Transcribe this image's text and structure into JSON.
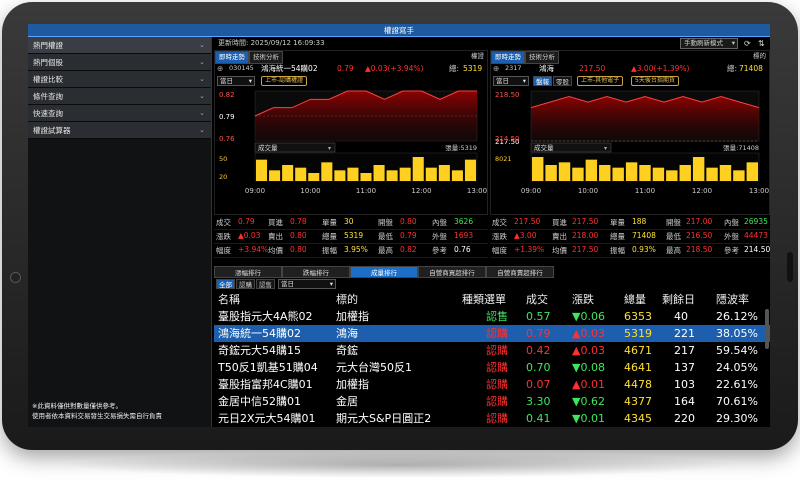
{
  "window": {
    "title": "權證寫手"
  },
  "sidebar": {
    "items": [
      {
        "label": "熱門權證"
      },
      {
        "label": "熱門個股"
      },
      {
        "label": "權證比較"
      },
      {
        "label": "條件查詢"
      },
      {
        "label": "快速查詢"
      },
      {
        "label": "權證試算器"
      }
    ],
    "disclaimer_1": "※此資料僅供對數量僅供參考。",
    "disclaimer_2": "使用者依本資料交易發生交易損失需自行負責"
  },
  "topbar": {
    "updated": "更新時間: 2025/09/12 16:09:33",
    "refresh_mode": "手動刷新模式"
  },
  "left_panel": {
    "tab_live": "即時走勢",
    "tab_tech": "技術分析",
    "tab_right": "權證",
    "code": "030145",
    "name": "鴻海統一54購02",
    "price": "0.79",
    "change": "▲0.03(+3.94%)",
    "vol_label": "總:",
    "volume": "5319",
    "period": "當日",
    "tag1": "上市-認購權證",
    "volume_dd": "成交量",
    "vol_readout": "張量:5319"
  },
  "right_panel": {
    "tab_live": "即時走勢",
    "tab_tech": "技術分析",
    "tab_right": "標的",
    "code": "2317",
    "name": "鴻海",
    "price": "217.50",
    "change": "▲3.00(+1.39%)",
    "vol_label": "總:",
    "volume": "71408",
    "period": "當日",
    "mini_tab1": "盤報",
    "mini_tab2": "零股",
    "tag1": "上市-其他電子",
    "tag2": "5天後台指期貨",
    "volume_dd": "成交量",
    "vol_readout": "張量:71408"
  },
  "chart_data": [
    {
      "type": "line",
      "title": "鴻海統一54購02",
      "x": [
        "09:00",
        "10:00",
        "11:00",
        "12:00",
        "13:00"
      ],
      "y_ticks": [
        "0.82",
        "0.79",
        "0.76",
        "50",
        "20"
      ],
      "ylim": [
        0.76,
        0.82
      ],
      "reference": 0.79,
      "series": [
        {
          "values": [
            0.79,
            0.8,
            0.8,
            0.81,
            0.81,
            0.82,
            0.82,
            0.81,
            0.82,
            0.82,
            0.81,
            0.82,
            0.82
          ]
        }
      ],
      "volume_bars": [
        8,
        4,
        6,
        5,
        3,
        7,
        4,
        5,
        3,
        6,
        4,
        5,
        9,
        5,
        6,
        4,
        8
      ]
    },
    {
      "type": "line",
      "title": "鴻海",
      "x": [
        "09:00",
        "10:00",
        "11:00",
        "12:00",
        "13:00"
      ],
      "y_ticks": [
        "218.50",
        "217.50",
        "214.50",
        "8021"
      ],
      "ylim": [
        214.5,
        219
      ],
      "reference": 214.5,
      "series": [
        {
          "values": [
            217.5,
            218.0,
            218.5,
            218.0,
            218.5,
            218.0,
            218.5,
            218.0,
            218.5,
            218.0,
            218.5,
            218.0,
            217.5
          ]
        }
      ],
      "volume_bars": [
        9,
        6,
        7,
        5,
        8,
        6,
        5,
        7,
        6,
        5,
        4,
        6,
        9,
        5,
        6,
        4,
        7
      ]
    }
  ],
  "left_grid": [
    [
      "成交",
      "0.79",
      "買進",
      "0.78",
      "單量",
      "30",
      "開盤",
      "0.80",
      "內盤",
      "3626"
    ],
    [
      "漲跌",
      "▲0.03",
      "賣出",
      "0.80",
      "總量",
      "5319",
      "最低",
      "0.79",
      "外盤",
      "1693"
    ],
    [
      "幅度",
      "+3.94%",
      "均價",
      "0.80",
      "振幅",
      "3.95%",
      "最高",
      "0.82",
      "參考",
      "0.76"
    ]
  ],
  "right_grid": [
    [
      "成交",
      "217.50",
      "買進",
      "217.50",
      "單量",
      "188",
      "開盤",
      "217.00",
      "內盤",
      "26935"
    ],
    [
      "漲跌",
      "▲3.00",
      "賣出",
      "218.00",
      "總量",
      "71408",
      "最低",
      "216.50",
      "外盤",
      "44473"
    ],
    [
      "幅度",
      "+1.39%",
      "均價",
      "217.50",
      "振幅",
      "0.93%",
      "最高",
      "218.50",
      "參考",
      "214.50"
    ]
  ],
  "category_tabs": [
    "漲幅排行",
    "跌幅排行",
    "成量排行",
    "自營商買超排行",
    "自營商賣超排行"
  ],
  "filters": {
    "all": "全部",
    "call": "認購",
    "put": "認售",
    "period": "當日"
  },
  "table": {
    "headers": [
      "名稱",
      "標的",
      "種類選單",
      "成交",
      "漲跌",
      "總量",
      "剩餘日",
      "隱波率"
    ],
    "rows": [
      [
        "臺股指元大4A熊02",
        "加權指",
        "認售",
        "0.57",
        "▼0.06",
        "6353",
        "40",
        "26.12%"
      ],
      [
        "鴻海統一54購02",
        "鴻海",
        "認購",
        "0.79",
        "▲0.03",
        "5319",
        "221",
        "38.05%"
      ],
      [
        "奇鋐元大54購15",
        "奇鋐",
        "認購",
        "0.42",
        "▲0.03",
        "4671",
        "217",
        "59.54%"
      ],
      [
        "T50反1凱基51購04",
        "元大台灣50反1",
        "認購",
        "0.70",
        "▼0.08",
        "4641",
        "137",
        "24.05%"
      ],
      [
        "臺股指富邦4C購01",
        "加權指",
        "認購",
        "0.07",
        "▲0.01",
        "4478",
        "103",
        "22.61%"
      ],
      [
        "金居中信52購01",
        "金居",
        "認購",
        "3.30",
        "▼0.62",
        "4377",
        "164",
        "70.61%"
      ],
      [
        "元日2X元大54購01",
        "期元大S&P日圓正2",
        "認購",
        "0.41",
        "▼0.01",
        "4345",
        "220",
        "29.30%"
      ]
    ]
  },
  "colors": {
    "up": "#ff3030",
    "down": "#3ee65c",
    "volume": "#ffe030",
    "accent": "#1d5fae"
  }
}
